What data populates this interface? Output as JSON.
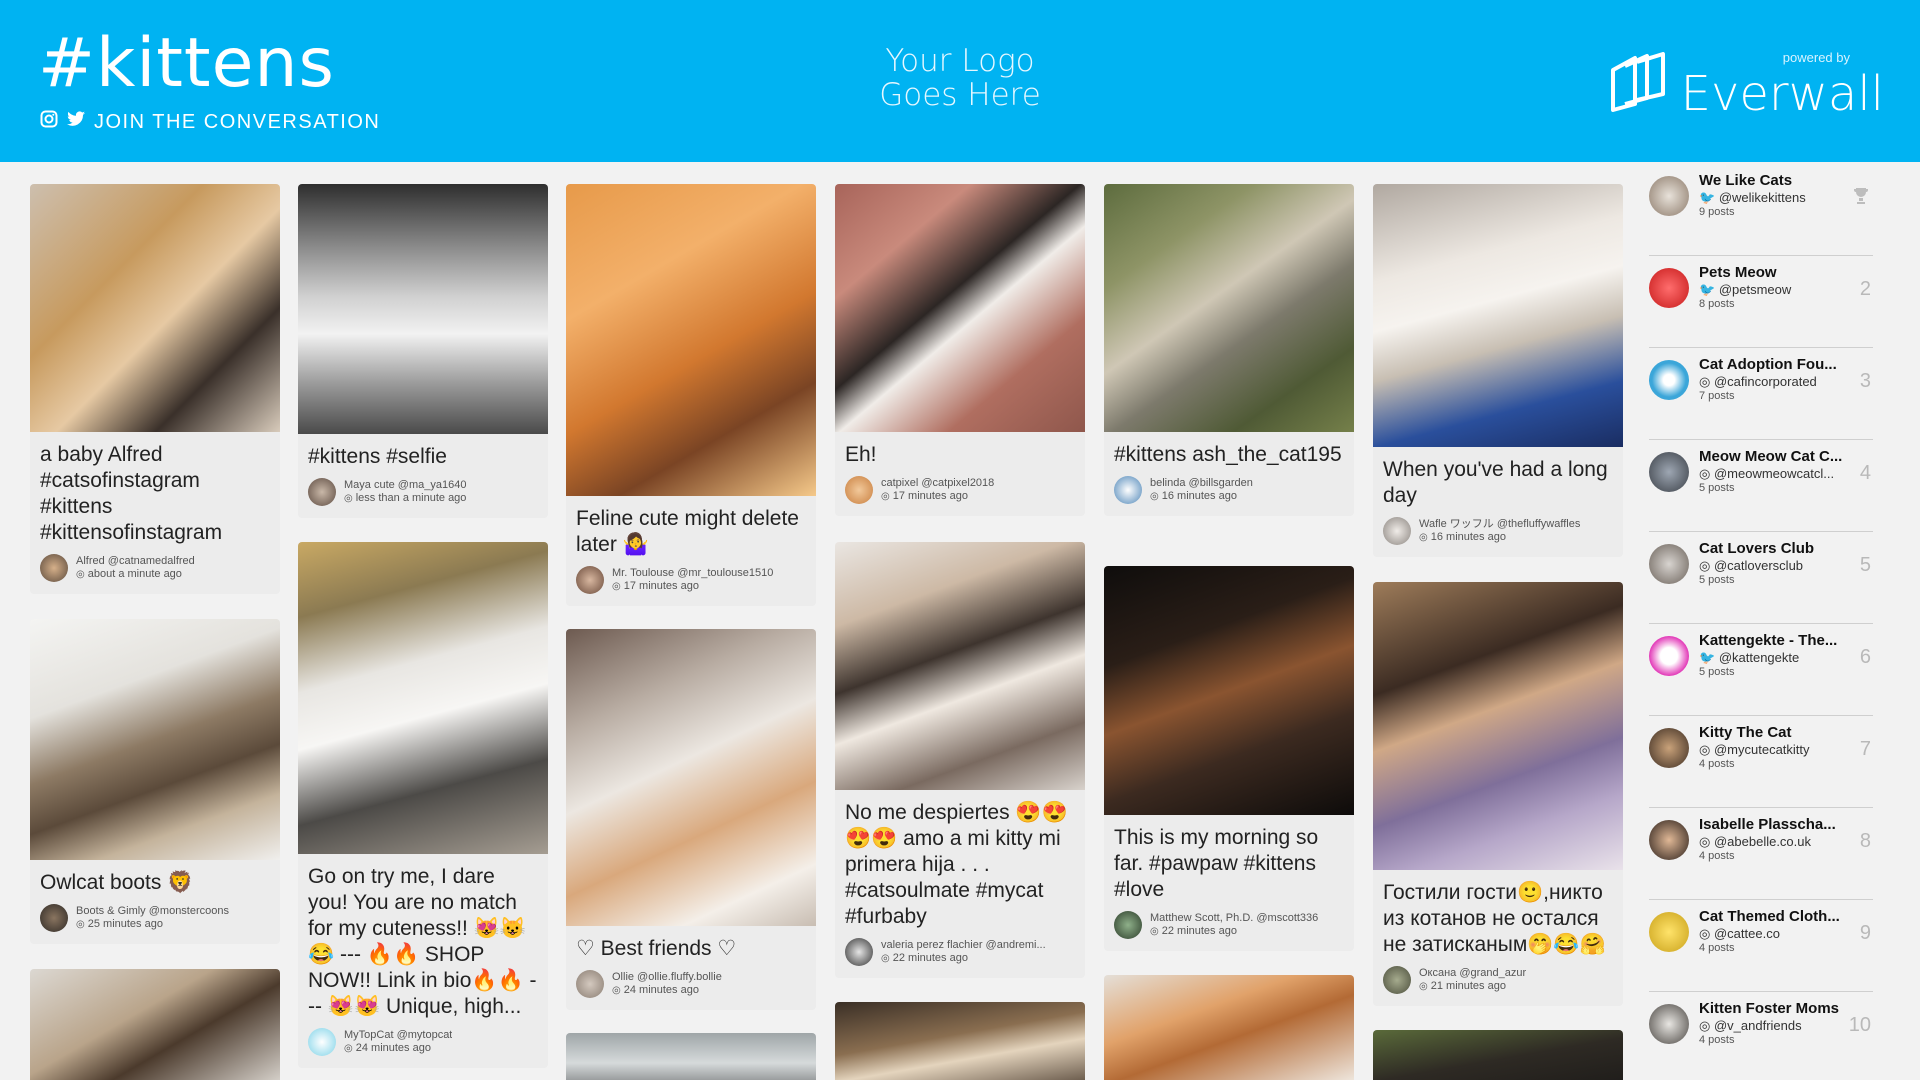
{
  "header": {
    "hashtag": "#kittens",
    "join": "JOIN THE CONVERSATION",
    "logo_placeholder": "Your Logo Goes Here",
    "powered_by": "powered by",
    "brand": "Everwall"
  },
  "posts": [
    {
      "caption": "a baby Alfred #catsofinstagram #kittens #kittensofinstagram",
      "author": "Alfred @catnamedalfred",
      "time": "about a minute ago",
      "network": "instagram"
    },
    {
      "caption": "Owlcat boots 🦁",
      "author": "Boots & Gimly @monstercoons",
      "time": "25 minutes ago",
      "network": "instagram"
    },
    {
      "caption": "",
      "author": "",
      "time": "",
      "network": "instagram"
    },
    {
      "caption": "#kittens #selfie",
      "author": "Maya cute @ma_ya1640",
      "time": "less than a minute ago",
      "network": "instagram"
    },
    {
      "caption": "Go on try me, I dare you! You are no match for my cuteness!! 😻😺😂 --- 🔥🔥 SHOP NOW!! Link in bio🔥🔥 --- 😻😻 Unique, high...",
      "author": "MyTopCat @mytopcat",
      "time": "24 minutes ago",
      "network": "instagram"
    },
    {
      "caption": "Feline cute might delete later 🤷‍♀️",
      "author": "Mr. Toulouse @mr_toulouse1510",
      "time": "17 minutes ago",
      "network": "instagram"
    },
    {
      "caption": "♡ Best friends ♡",
      "author": "Ollie @ollie.fluffy.bollie",
      "time": "24 minutes ago",
      "network": "instagram"
    },
    {
      "caption": "",
      "author": "",
      "time": "",
      "network": "instagram"
    },
    {
      "caption": "Eh!",
      "author": "catpixel @catpixel2018",
      "time": "17 minutes ago",
      "network": "instagram"
    },
    {
      "caption": "No me despiertes 😍😍😍😍 amo a mi kitty mi primera hija . . . #catsoulmate #mycat #furbaby",
      "author": "valeria perez flachier @andremi...",
      "time": "22 minutes ago",
      "network": "instagram"
    },
    {
      "caption": "",
      "author": "",
      "time": "",
      "network": "instagram"
    },
    {
      "caption": "#kittens ash_the_cat195",
      "author": "belinda @billsgarden",
      "time": "16 minutes ago",
      "network": "instagram"
    },
    {
      "caption": "This is my morning so far. #pawpaw #kittens #love",
      "author": "Matthew Scott, Ph.D. @mscott336",
      "time": "22 minutes ago",
      "network": "instagram"
    },
    {
      "caption": "",
      "author": "",
      "time": "",
      "network": "instagram"
    },
    {
      "caption": "When you've had a long day",
      "author": "Wafle ワッフル @thefluffywaffles",
      "time": "16 minutes ago",
      "network": "instagram"
    },
    {
      "caption": "Гостили гости🙂,никто из котанов не остался не затисканым🤭😂🤗",
      "author": "Оксана @grand_azur",
      "time": "21 minutes ago",
      "network": "instagram"
    },
    {
      "caption": "",
      "author": "",
      "time": "",
      "network": "instagram"
    }
  ],
  "leaderboard": [
    {
      "name": "We Like Cats",
      "handle": "@welikekittens",
      "posts": "9 posts",
      "network": "twitter",
      "rank": "",
      "trophy": true
    },
    {
      "name": "Pets Meow",
      "handle": "@petsmeow",
      "posts": "8 posts",
      "network": "twitter",
      "rank": "2"
    },
    {
      "name": "Cat Adoption Fou...",
      "handle": "@cafincorporated",
      "posts": "7 posts",
      "network": "instagram",
      "rank": "3"
    },
    {
      "name": "Meow Meow Cat C...",
      "handle": "@meowmeowcatcl...",
      "posts": "5 posts",
      "network": "instagram",
      "rank": "4"
    },
    {
      "name": "Cat Lovers Club",
      "handle": "@catloversclub",
      "posts": "5 posts",
      "network": "instagram",
      "rank": "5"
    },
    {
      "name": "Kattengekte - The...",
      "handle": "@kattengekte",
      "posts": "5 posts",
      "network": "twitter",
      "rank": "6"
    },
    {
      "name": "Kitty The Cat",
      "handle": "@mycutecatkitty",
      "posts": "4 posts",
      "network": "instagram",
      "rank": "7"
    },
    {
      "name": "Isabelle Plasscha...",
      "handle": "@abebelle.co.uk",
      "posts": "4 posts",
      "network": "instagram",
      "rank": "8"
    },
    {
      "name": "Cat Themed Cloth...",
      "handle": "@cattee.co",
      "posts": "4 posts",
      "network": "instagram",
      "rank": "9"
    },
    {
      "name": "Kitten Foster Moms",
      "handle": "@v_andfriends",
      "posts": "4 posts",
      "network": "instagram",
      "rank": "10"
    }
  ],
  "colors": {
    "header_bg": "#00b3f2",
    "card_bg": "#ececec",
    "page_bg": "#f2f2f2"
  }
}
